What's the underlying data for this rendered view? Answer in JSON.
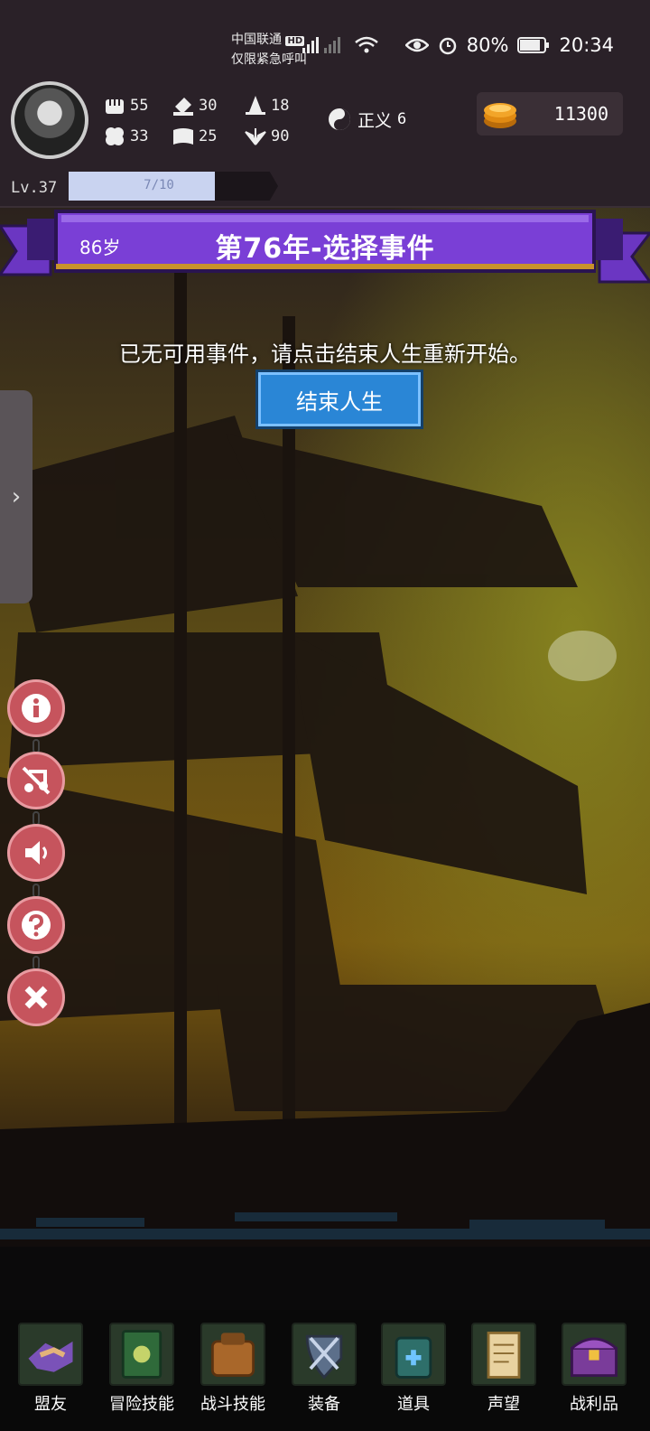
{
  "status_bar": {
    "carrier_line1": "中国联通",
    "carrier_hd": "HD",
    "carrier_line2": "仅限紧急呼叫",
    "battery": "80%",
    "time": "20:34"
  },
  "player": {
    "stats": {
      "strength": "55",
      "build": "30",
      "magic": "18",
      "luck": "33",
      "defense": "25",
      "spirit": "90"
    },
    "alignment_label": "正义",
    "alignment_value": "6",
    "gold": "11300",
    "level": "Lv.37",
    "xp_text": "7/10",
    "xp_fraction": 0.7
  },
  "banner": {
    "age": "86岁",
    "title": "第76年-选择事件"
  },
  "main": {
    "message": "已无可用事件，请点击结束人生重新开始。",
    "end_button": "结束人生"
  },
  "side_buttons": [
    "info-icon",
    "music-off-icon",
    "sound-icon",
    "help-icon",
    "close-icon"
  ],
  "nav": [
    {
      "label": "盟友",
      "icon": "allies-icon"
    },
    {
      "label": "冒险技能",
      "icon": "adventure-skill-icon"
    },
    {
      "label": "战斗技能",
      "icon": "battle-skill-icon"
    },
    {
      "label": "装备",
      "icon": "equipment-icon"
    },
    {
      "label": "道具",
      "icon": "items-icon"
    },
    {
      "label": "声望",
      "icon": "reputation-icon"
    },
    {
      "label": "战利品",
      "icon": "loot-icon"
    }
  ],
  "colors": {
    "banner_purple": "#7a3fd6",
    "button_blue": "#2a86d6",
    "round_button": "#c6545d"
  }
}
